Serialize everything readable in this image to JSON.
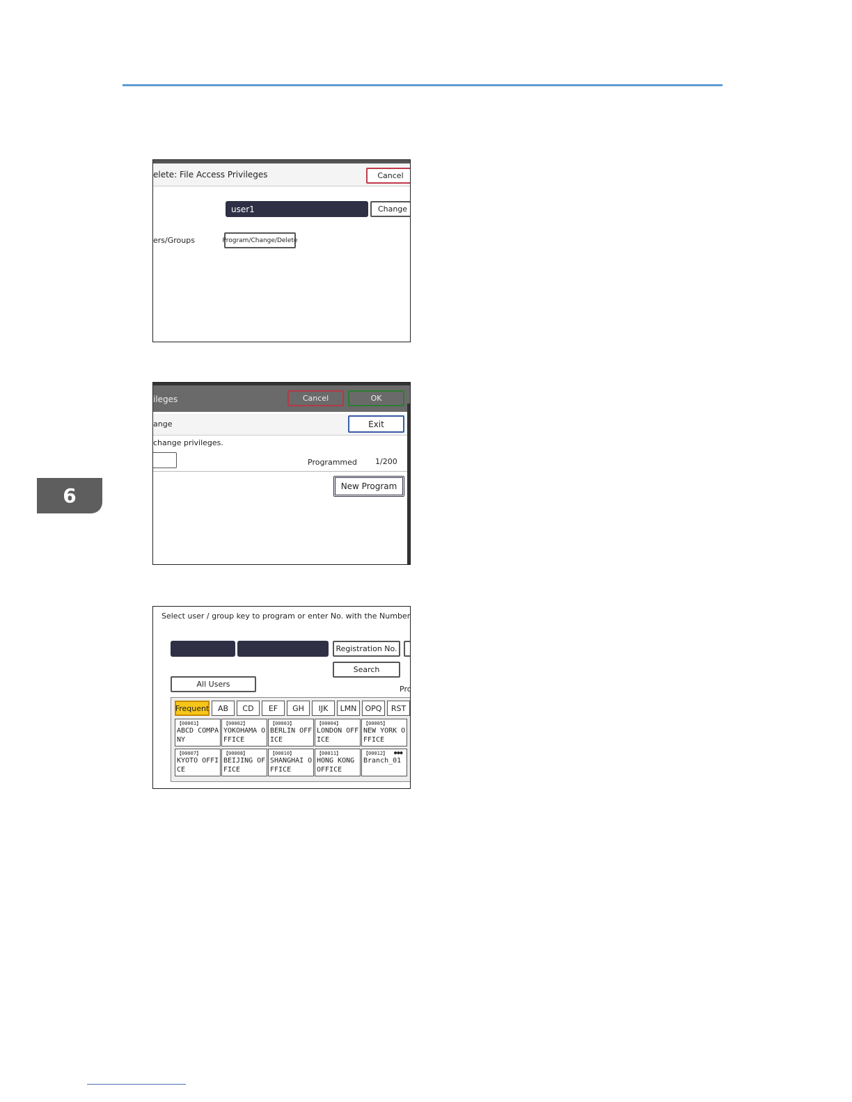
{
  "chapter": {
    "number": "6"
  },
  "screenshot1": {
    "title": "elete: File Access Privileges",
    "cancel_label": "Cancel",
    "owner_value": "user1",
    "change_label": "Change",
    "users_groups_label": "ers/Groups",
    "program_change_delete_label": "Program/Change/Delete"
  },
  "screenshot2": {
    "header_title": "ileges",
    "cancel_label": "Cancel",
    "ok_label": "OK",
    "sub_title": "ange",
    "exit_label": "Exit",
    "instruction": "change privileges.",
    "programmed_label": "Programmed",
    "programmed_count": "1/200",
    "new_program_label": "New Program"
  },
  "screenshot3": {
    "instruction": "Select user / group key to program or enter No. with the Number keys.",
    "registration_no_label": "Registration No.",
    "search_label": "Search",
    "all_users_label": "All Users",
    "pro_label": "Pro",
    "tabs": [
      "Frequent",
      "AB",
      "CD",
      "EF",
      "GH",
      "IJK",
      "LMN",
      "OPQ",
      "RST"
    ],
    "entries": [
      {
        "num": "【00001】",
        "name": "ABCD COMPANY"
      },
      {
        "num": "【00002】",
        "name": "YOKOHAMA OFFICE"
      },
      {
        "num": "【00003】",
        "name": "BERLIN OFFICE"
      },
      {
        "num": "【00004】",
        "name": "LONDON OFFICE"
      },
      {
        "num": "【00005】",
        "name": "NEW YORK OFFICE"
      },
      {
        "num": "【00007】",
        "name": "KYOTO OFFICE"
      },
      {
        "num": "【00008】",
        "name": "BEIJING OFFICE"
      },
      {
        "num": "【00010】",
        "name": "SHANGHAI OFFICE"
      },
      {
        "num": "【00011】",
        "name": "HONG KONG OFFICE"
      },
      {
        "num": "【00012】",
        "name": "Branch_01"
      }
    ]
  }
}
